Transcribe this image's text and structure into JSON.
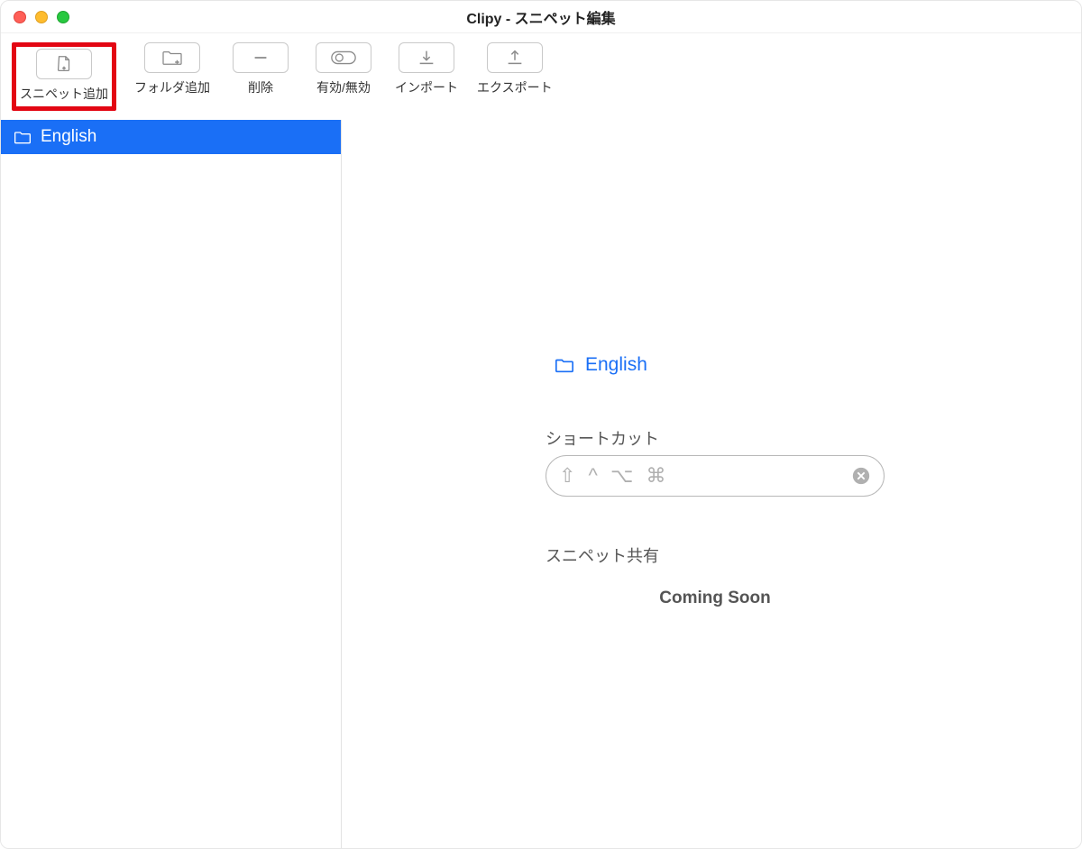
{
  "window": {
    "title": "Clipy - スニペット編集"
  },
  "toolbar": {
    "add_snippet": "スニペット追加",
    "add_folder": "フォルダ追加",
    "delete": "削除",
    "enable_disable": "有効/無効",
    "import": "インポート",
    "export": "エクスポート"
  },
  "sidebar": {
    "items": [
      {
        "label": "English",
        "selected": true
      }
    ]
  },
  "detail": {
    "folder_name": "English",
    "shortcut_label": "ショートカット",
    "shortcut_symbols": "⇧ ^ ⌥ ⌘",
    "share_label": "スニペット共有",
    "coming_soon": "Coming Soon"
  }
}
